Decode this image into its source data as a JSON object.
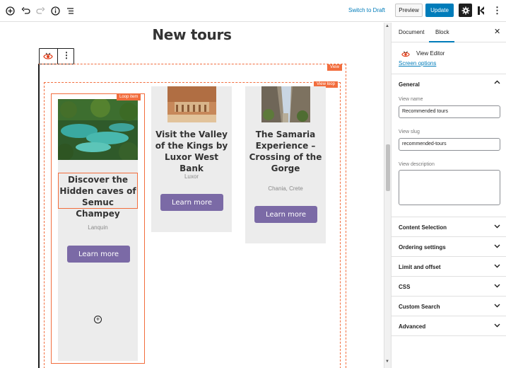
{
  "toolbar": {
    "switch_to_draft": "Switch to Draft",
    "preview": "Preview",
    "update": "Update",
    "icons": [
      "add-block-icon",
      "undo-icon",
      "redo-icon",
      "info-icon",
      "list-view-icon",
      "settings-gear-icon",
      "kadence-icon",
      "more-vertical-icon"
    ]
  },
  "canvas": {
    "page_title": "New tours",
    "badges": {
      "view": "View",
      "view_loop": "View loop",
      "loop_item": "Loop item"
    },
    "cards": [
      {
        "title": "Discover the Hidden caves of Semuc Champey",
        "location": "Lanquin",
        "button": "Learn more"
      },
      {
        "title": "Visit the Valley of the Kings by Luxor West Bank",
        "location": "Luxor",
        "button": "Learn more"
      },
      {
        "title": "The Samaria Experience – Crossing of the Gorge",
        "location": "Chania, Crete",
        "button": "Learn more"
      }
    ]
  },
  "sidebar": {
    "tabs": [
      "Document",
      "Block"
    ],
    "active_tab": "Block",
    "block_name": "View Editor",
    "screen_options": "Screen options",
    "general": {
      "title": "General",
      "view_name_label": "View name",
      "view_name_value": "Recommended tours",
      "view_slug_label": "View slug",
      "view_slug_value": "recommended-tours",
      "view_description_label": "View description",
      "view_description_value": ""
    },
    "panels": [
      "Content Selection",
      "Ordering settings",
      "Limit and offset",
      "CSS",
      "Custom Search",
      "Advanced"
    ]
  },
  "colors": {
    "accent": "#007cba",
    "loop_outline": "#f26d3d",
    "button": "#7b6aa6",
    "card_bg": "#ececec"
  }
}
